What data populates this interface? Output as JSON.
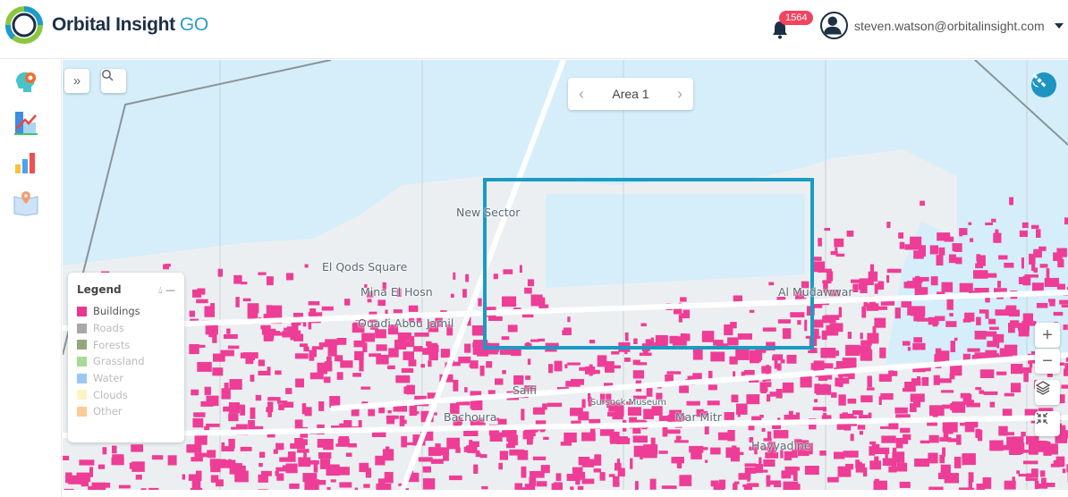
{
  "header": {
    "brand_name": "Orbital Insight",
    "brand_suffix": "GO",
    "notification_count": "1564",
    "user_email": "steven.watson@orbitalinsight.com"
  },
  "sidebar": {
    "items": [
      {
        "icon": "head-gear-icon"
      },
      {
        "icon": "building-growth-icon"
      },
      {
        "icon": "bar-chart-icon"
      },
      {
        "icon": "map-pin-book-icon"
      }
    ]
  },
  "map": {
    "area_label": "Area 1",
    "labels": [
      "New Sector",
      "El Qods Square",
      "Mina El Hosn",
      "Ouadi Abou Jamil",
      "Al Mudawwar",
      "Saifi",
      "Bachoura",
      "Mar Mitr",
      "Sursock Museum",
      "Hayyadine"
    ],
    "selection_color": "#1a9bc4",
    "building_color": "#ee3d96"
  },
  "legend": {
    "title": "Legend",
    "items": [
      {
        "label": "Buildings",
        "color": "#e8388f"
      },
      {
        "label": "Roads",
        "color": "#a8a8a8"
      },
      {
        "label": "Forests",
        "color": "#93a67c"
      },
      {
        "label": "Grassland",
        "color": "#a6da95"
      },
      {
        "label": "Water",
        "color": "#9ac8f5"
      },
      {
        "label": "Clouds",
        "color": "#fdf4c4"
      },
      {
        "label": "Other",
        "color": "#fccb98"
      }
    ]
  }
}
